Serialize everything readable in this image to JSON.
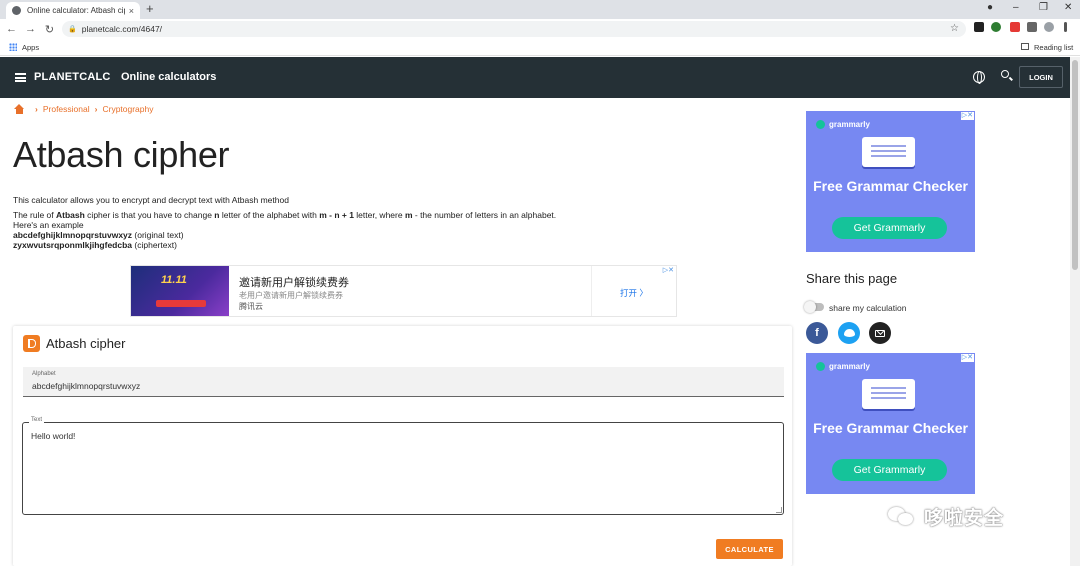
{
  "browser": {
    "tab_title": "Online calculator: Atbash ciph",
    "tab_close": "×",
    "new_tab": "+",
    "url": "planetcalc.com/4647/",
    "bookmarks": {
      "apps": "Apps",
      "reading_list": "Reading list"
    }
  },
  "header": {
    "brand": "PLANETCALC",
    "title": "Online calculators",
    "login": "LOGIN"
  },
  "breadcrumb": [
    "Professional",
    "Cryptography"
  ],
  "page": {
    "title": "Atbash cipher",
    "intro": "This calculator allows you to encrypt and decrypt text with Atbash method",
    "rule_prefix": "The rule of ",
    "rule_bold1": "Atbash",
    "rule_mid1": " cipher is that you have to change ",
    "rule_bold2": "n",
    "rule_mid2": " letter of the alphabet with ",
    "rule_bold3": "m - n + 1",
    "rule_mid3": " letter, where ",
    "rule_bold4": "m",
    "rule_suffix": " - the number of letters in an alphabet.",
    "example_intro": "Here's an example",
    "original": "abcdefghijklmnopqrstuvwxyz",
    "original_note": " (original text)",
    "cipher": "zyxwvutsrqponmlkjihgfedcba",
    "cipher_note": " (ciphertext)"
  },
  "ad_mid": {
    "banner": "11.11",
    "headline": "邀请新用户解锁续费券",
    "sub": "老用户邀请新用户解锁续费券",
    "brand": "腾讯云",
    "cta": "打开 〉",
    "close": "▷✕"
  },
  "calculator": {
    "title": "Atbash cipher",
    "alphabet_label": "Alphabet",
    "alphabet_value": "abcdefghijklmnopqrstuvwxyz",
    "text_label": "Text",
    "text_value": "Hello world!",
    "calculate": "CALCULATE"
  },
  "ad_right": {
    "brand": "grammarly",
    "headline": "Free Grammar Checker",
    "cta": "Get Grammarly",
    "close": "▷✕"
  },
  "share": {
    "title": "Share this page",
    "toggle_label": "share my calculation",
    "facebook": "f"
  },
  "watermark": "哆啦安全"
}
